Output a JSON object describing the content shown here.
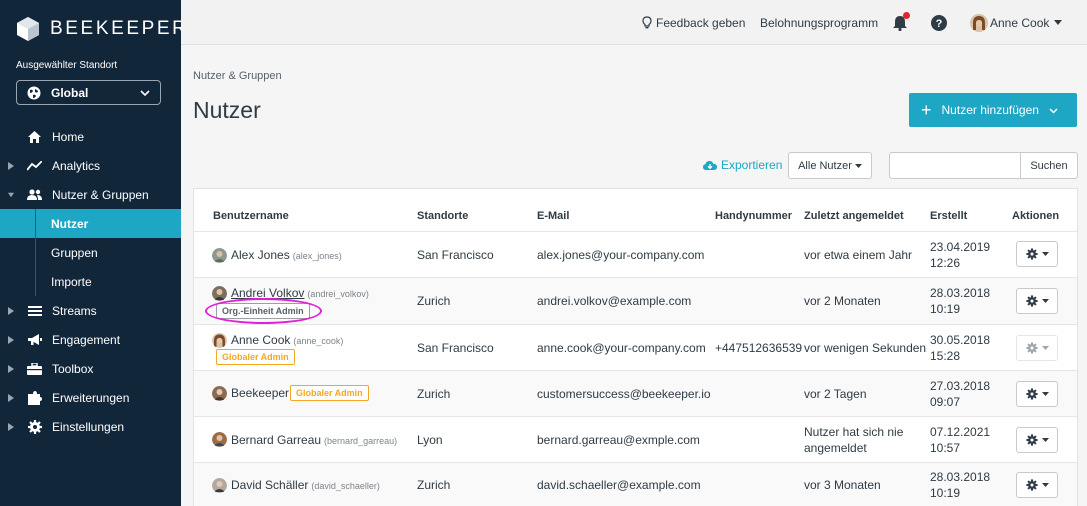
{
  "app": {
    "logo_text": "BEEKEEPER"
  },
  "sidebar": {
    "location_label": "Ausgewählter Standort",
    "location_value": "Global",
    "items": [
      {
        "label": "Home",
        "icon": "home-icon"
      },
      {
        "label": "Analytics",
        "icon": "analytics-icon"
      },
      {
        "label": "Nutzer & Gruppen",
        "icon": "users-icon"
      },
      {
        "label": "Streams",
        "icon": "streams-icon"
      },
      {
        "label": "Engagement",
        "icon": "megaphone-icon"
      },
      {
        "label": "Toolbox",
        "icon": "toolbox-icon"
      },
      {
        "label": "Erweiterungen",
        "icon": "puzzle-icon"
      },
      {
        "label": "Einstellungen",
        "icon": "gear-icon"
      }
    ],
    "subitems": [
      {
        "label": "Nutzer",
        "active": true
      },
      {
        "label": "Gruppen"
      },
      {
        "label": "Importe"
      }
    ]
  },
  "topbar": {
    "feedback": "Feedback geben",
    "rewards": "Belohnungsprogramm",
    "user_name": "Anne Cook"
  },
  "main": {
    "breadcrumb": "Nutzer & Gruppen",
    "title": "Nutzer",
    "add_button": "Nutzer hinzufügen",
    "export": "Exportieren",
    "filter": "Alle Nutzer",
    "search_button": "Suchen",
    "search_value": ""
  },
  "table": {
    "headers": [
      "Benutzername",
      "Standorte",
      "E-Mail",
      "Handynummer",
      "Zuletzt angemeldet",
      "Erstellt",
      "Aktionen"
    ],
    "rows": [
      {
        "name": "Alex Jones",
        "handle": "(alex_jones)",
        "badge": "",
        "location": "San Francisco",
        "email": "alex.jones@your-company.com",
        "phone": "",
        "last_login": "vor etwa einem Jahr",
        "last_login_2": "",
        "created_date": "23.04.2019",
        "created_time": "12:26",
        "actions_enabled": true
      },
      {
        "name": "Andrei Volkov",
        "handle": "(andrei_volkov)",
        "badge": "Org.-Einheit Admin",
        "location": "Zurich",
        "email": "andrei.volkov@example.com",
        "phone": "",
        "last_login": "vor 2 Monaten",
        "last_login_2": "",
        "created_date": "28.03.2018",
        "created_time": "10:19",
        "actions_enabled": true
      },
      {
        "name": "Anne Cook",
        "handle": "(anne_cook)",
        "badge": "Globaler Admin",
        "location": "San Francisco",
        "email": "anne.cook@your-company.com",
        "phone": "+447512636539",
        "last_login": "vor wenigen Sekunden",
        "last_login_2": "",
        "created_date": "30.05.2018",
        "created_time": "15:28",
        "actions_enabled": false
      },
      {
        "name": "Beekeeper",
        "handle": "",
        "badge": "Globaler Admin",
        "location": "Zurich",
        "email": "customersuccess@beekeeper.io",
        "phone": "",
        "last_login": "vor 2 Tagen",
        "last_login_2": "",
        "created_date": "27.03.2018",
        "created_time": "09:07",
        "actions_enabled": true
      },
      {
        "name": "Bernard Garreau",
        "handle": "(bernard_garreau)",
        "badge": "",
        "location": "Lyon",
        "email": "bernard.garreau@exmple.com",
        "phone": "",
        "last_login": "Nutzer hat sich nie",
        "last_login_2": "angemeldet",
        "created_date": "07.12.2021",
        "created_time": "10:57",
        "actions_enabled": true
      },
      {
        "name": "David Schäller",
        "handle": "(david_schaeller)",
        "badge": "",
        "location": "Zurich",
        "email": "david.schaeller@example.com",
        "phone": "",
        "last_login": "vor 3 Monaten",
        "last_login_2": "",
        "created_date": "28.03.2018",
        "created_time": "10:19",
        "actions_enabled": true
      }
    ]
  },
  "colors": {
    "sidebar_bg": "#12263a",
    "accent": "#1ea7c4",
    "admin_badge": "#f5a623",
    "highlight": "#e020d8",
    "notification": "#e7222d"
  }
}
